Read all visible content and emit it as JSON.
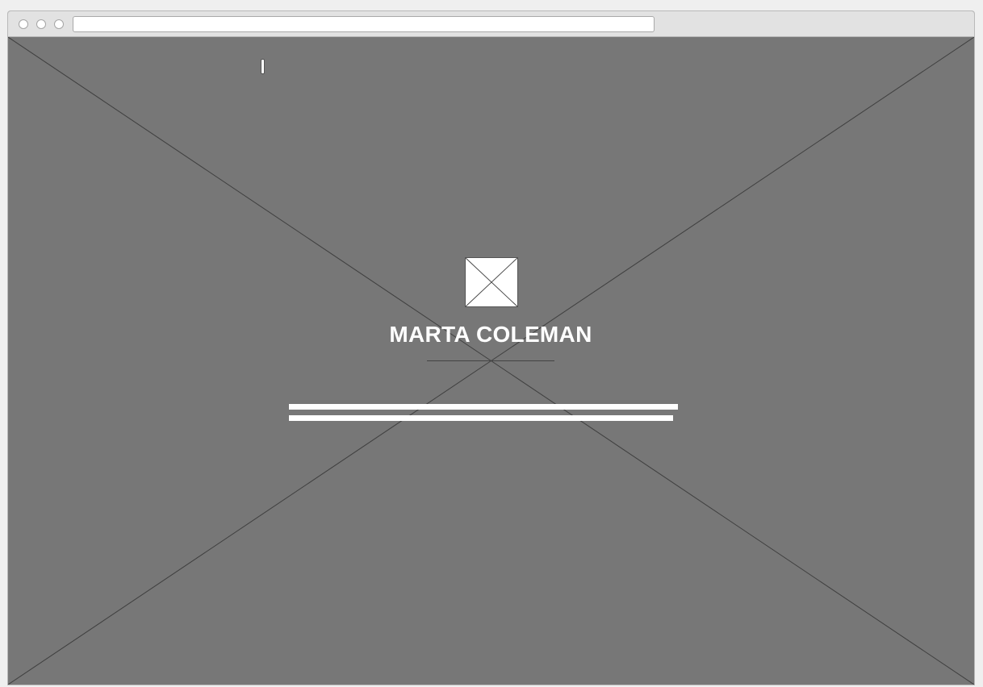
{
  "browser": {
    "address_bar_value": ""
  },
  "hero": {
    "background_image": "image-placeholder",
    "avatar_image": "image-placeholder",
    "name": "MARTA COLEMAN",
    "description_lines": 2
  },
  "colors": {
    "hero_background": "#777777",
    "hero_text": "#ffffff",
    "titlebar": "#e2e2e2"
  }
}
